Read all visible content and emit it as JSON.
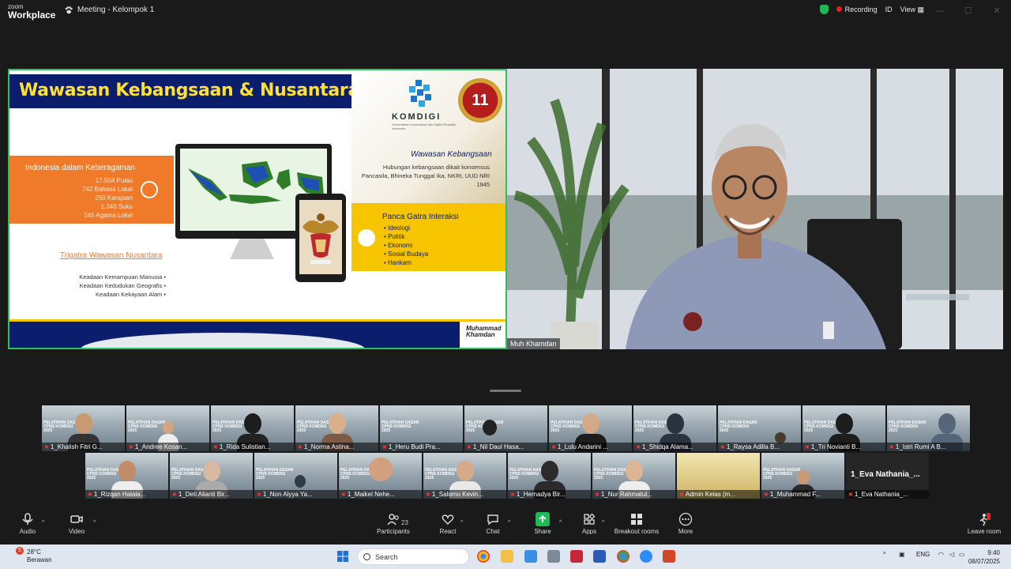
{
  "app": {
    "logo_line1": "zoom",
    "logo_line2": "Workplace",
    "meeting_title": "Meeting - Kelompok 1",
    "recording_label": "Recording",
    "id_label": "ID",
    "view_label": "View"
  },
  "slide": {
    "title": "Wawasan Kebangsaan & Nusantara",
    "brand": "KOMDIGI",
    "brand_sub": "Kementerian Komunikasi dan Digital Republik Indonesia",
    "badge": "11",
    "diversity_title": "Indonesia dalam Keberagaman",
    "diversity_items": [
      "17.504 Pulau",
      "742 Bahasa Lokal",
      "250 Kerajaan",
      "1.340 Suku",
      "245 Agama Lokal"
    ],
    "trigatra_title": "Trigatra Wawasan Nusantara",
    "trigatra_items": [
      "Keadaan Kemampuan Manusia",
      "Keadaan Kedudukan Geografis",
      "Keadaan Kekayaan Alam"
    ],
    "wk_title": "Wawasan Kebangsaan",
    "wk_text": "Hubungan kebangsaan dikait konsensus Pancasila, Bhineka Tunggal Ika, NKRI, UUD NRI 1945",
    "pg_title": "Panca Gatra Interaksi",
    "pg_items": [
      "Ideologi",
      "Politik",
      "Ekonomi",
      "Sosial Budaya",
      "Hankam"
    ],
    "signature": "Muhammad Khamdan"
  },
  "speaker": {
    "name": "Muh Khamdan"
  },
  "gallery": {
    "row1": [
      "1_Khalish Fitri G...",
      "1_Andree Kosan...",
      "1_Rida Sulistian...",
      "1_Norma Astina...",
      "1_Heru Budi Pra...",
      "1_Nil Daul Hasa...",
      "1_Lulu Andarini ...",
      "1_Shidqa Alama...",
      "1_Raysa Adilla B...",
      "1_Tri Novianti B...",
      "1_Istri Rumi A B..."
    ],
    "row2": [
      "1_Rizqan Halala...",
      "1_Deti Alianti Bir...",
      "1_Non Alyya Ya...",
      "1_Maikel Nehe...",
      "1_Salomo Kevin...",
      "1_Hernadya Bir...",
      "1_Nur Rahmatul...",
      "Admin Kelas (m...",
      "1_Muhammad F...",
      "1_Eva Nathania_..."
    ],
    "name_only_big": "1_Eva Nathania_..."
  },
  "toolbar": {
    "audio": "Audio",
    "video": "Video",
    "participants": "Participants",
    "participants_count": "23",
    "react": "React",
    "chat": "Chat",
    "share": "Share",
    "apps": "Apps",
    "breakout": "Breakout rooms",
    "more": "More",
    "leave": "Leave room"
  },
  "taskbar": {
    "weather_temp": "28°C",
    "weather_desc": "Berawan",
    "weather_badge": "5",
    "search_placeholder": "Search",
    "lang": "ENG",
    "time": "9:40",
    "date": "08/07/2025"
  },
  "colors": {
    "accent_green": "#2fbf5f",
    "slide_navy": "#0b1e6e",
    "slide_yellow": "#f7c400",
    "slide_orange": "#ef7b2a",
    "record_red": "#e02020"
  }
}
